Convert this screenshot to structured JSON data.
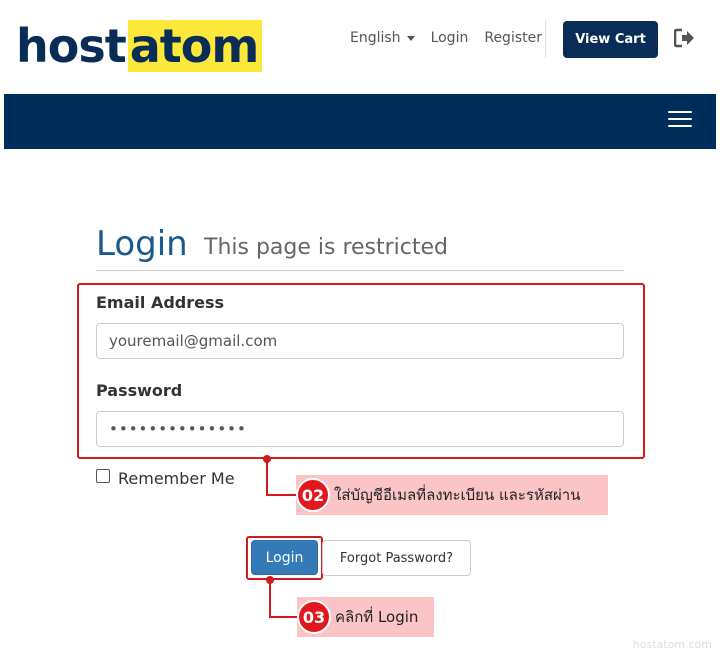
{
  "brand": {
    "part1": "host",
    "part2": "atom",
    "brand_yellow": "#fbe83b",
    "brand_navy": "#0a2d57"
  },
  "topnav": {
    "language": "English",
    "login": "Login",
    "register": "Register",
    "view_cart": "View Cart",
    "logout_icon": "sign-out-icon"
  },
  "navbar": {
    "menu_icon": "hamburger-menu-icon",
    "color": "#002e5b"
  },
  "page": {
    "title": "Login",
    "subtitle": "This page is restricted"
  },
  "form": {
    "email_label": "Email Address",
    "email_value": "youremail@gmail.com",
    "password_label": "Password",
    "password_value": "••••••••••••••",
    "remember_label": "Remember Me",
    "remember_checked": false,
    "login_button": "Login",
    "forgot_button": "Forgot Password?"
  },
  "annotations": {
    "step2": {
      "number": "02",
      "text": "ใส่บัญชีอีเมลที่ลงทะเบียน และรหัสผ่าน"
    },
    "step3": {
      "number": "03",
      "text": "คลิกที่ Login"
    },
    "highlight_color": "#d3191c"
  },
  "watermark": "hostatom.com"
}
